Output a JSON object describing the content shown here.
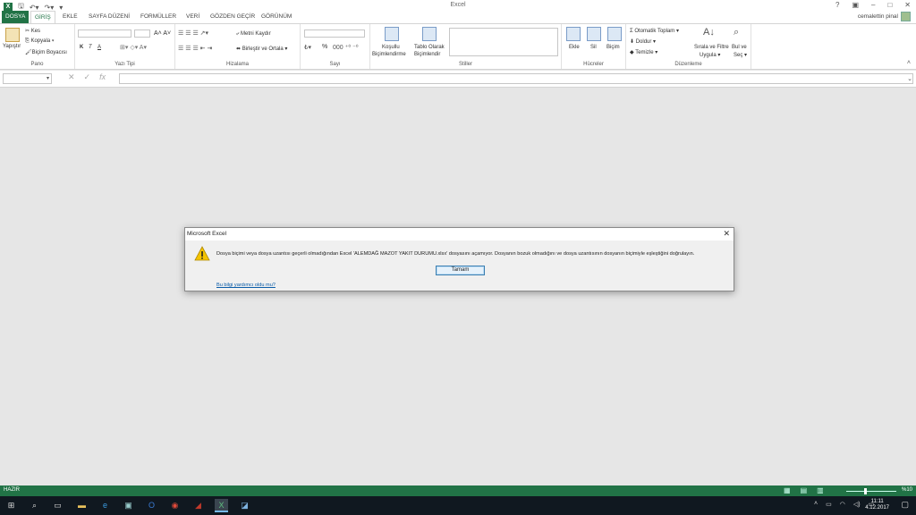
{
  "window": {
    "app_title": "Excel",
    "user_name": "cemalettin pinal"
  },
  "tabs": [
    "DOSYA",
    "GİRİŞ",
    "EKLE",
    "SAYFA DÜZENİ",
    "FORMÜLLER",
    "VERİ",
    "GÖZDEN GEÇİR",
    "GÖRÜNÜM"
  ],
  "ribbon": {
    "clipboard": {
      "paste": "Yapıştır",
      "cut": "Kes",
      "copy": "Kopyala",
      "format_painter": "Biçim Boyacısı",
      "label": "Pano"
    },
    "font": {
      "bold": "K",
      "italic": "T",
      "underline": "A",
      "label": "Yazı Tipi"
    },
    "alignment": {
      "wrap_text": "Metni Kaydır",
      "merge_center": "Birleştir ve Ortala",
      "label": "Hizalama"
    },
    "number": {
      "percent": "%",
      "label": "Sayı"
    },
    "styles": {
      "conditional_1": "Koşullu",
      "conditional_2": "Biçimlendirme",
      "table_1": "Tablo Olarak",
      "table_2": "Biçimlendir",
      "label": "Stiller"
    },
    "cells": {
      "insert": "Ekle",
      "delete": "Sil",
      "format": "Biçim",
      "label": "Hücreler"
    },
    "editing": {
      "autosum": "Otomatik Toplam",
      "fill": "Doldur",
      "clear": "Temizle",
      "sort_1": "Sırala ve Filtre",
      "sort_2": "Uygula",
      "find_1": "Bul ve",
      "find_2": "Seç",
      "label": "Düzenleme"
    }
  },
  "dialog": {
    "title": "Microsoft Excel",
    "message": "Dosya biçimi veya dosya uzantısı geçerli olmadığından Excel 'ALEMDAĞ MAZOT YAKIT DURUMU.xlsx' dosyasını açamıyor. Dosyanın bozuk olmadığını ve dosya uzantısının dosyanın biçimiyle eşleştiğini doğrulayın.",
    "ok_button": "Tamam",
    "help_link": "Bu bilgi yardımcı oldu mu?"
  },
  "status_bar": {
    "ready": "HAZIR",
    "zoom": "%10"
  },
  "taskbar": {
    "time": "11:11",
    "date": "4.12.2017"
  },
  "colors": {
    "accent": "#217346",
    "taskbar": "#101820"
  }
}
